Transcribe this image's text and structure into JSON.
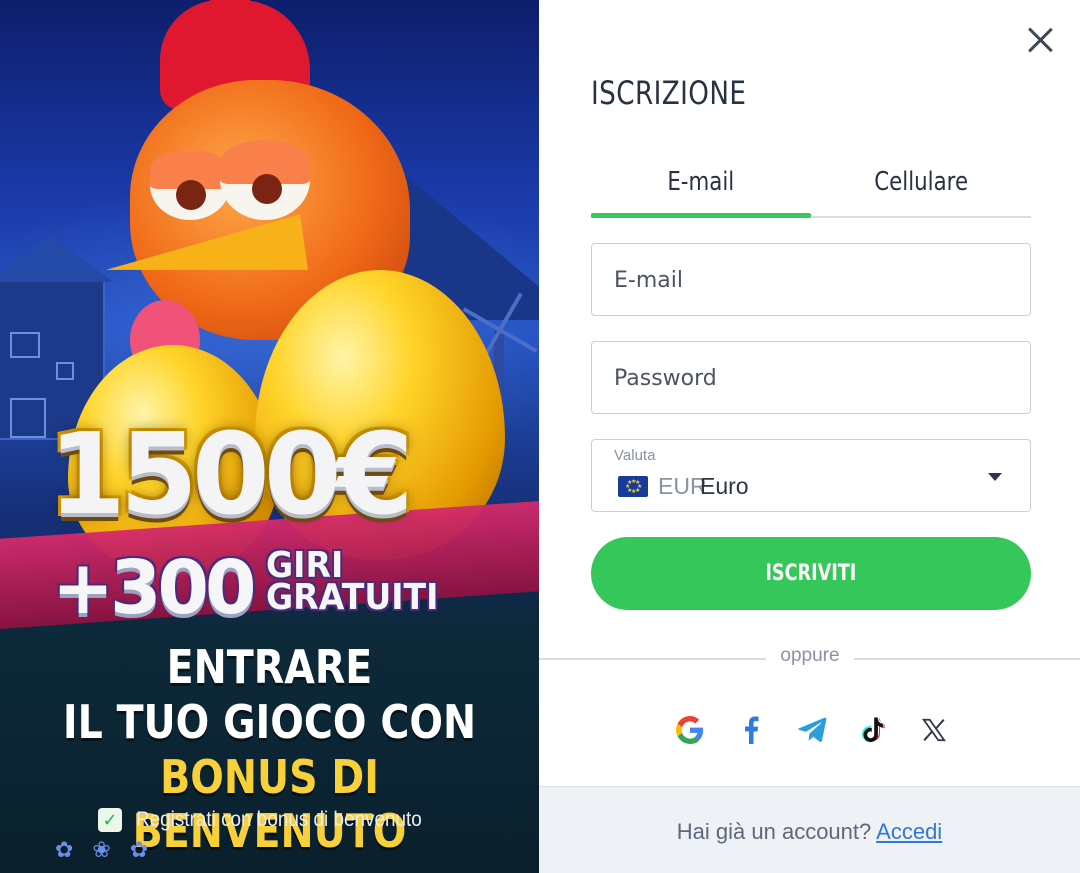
{
  "promo": {
    "amount": "1500€",
    "spins": "+300",
    "spins_label_1": "GIRI",
    "spins_label_2": "GRATUITI",
    "line1": "ENTRARE",
    "line2": "IL TUO GIOCO CON",
    "line3": "BONUS DI BENVENUTO",
    "checkbox_checked": true,
    "checkbox_label": "Registrati con bonus di benvenuto",
    "colors": {
      "headline_yellow": "#f8d13a",
      "check_green": "#2db34a"
    }
  },
  "form": {
    "title": "ISCRIZIONE",
    "tabs": [
      {
        "label": "E-mail",
        "active": true
      },
      {
        "label": "Cellulare",
        "active": false
      }
    ],
    "email_placeholder": "E-mail",
    "password_placeholder": "Password",
    "currency": {
      "label": "Valuta",
      "code": "EUR",
      "name": "Euro",
      "flag_icon": "eu-flag-icon"
    },
    "submit_label": "ISCRIVITI",
    "divider_label": "oppure",
    "socials": [
      "google-icon",
      "facebook-icon",
      "telegram-icon",
      "tiktok-icon",
      "x-icon"
    ],
    "footer_text": "Hai già un account?",
    "footer_link": "Accedi",
    "colors": {
      "accent_green": "#35c759",
      "link_blue": "#2f78d6",
      "text_dark": "#283242"
    }
  }
}
